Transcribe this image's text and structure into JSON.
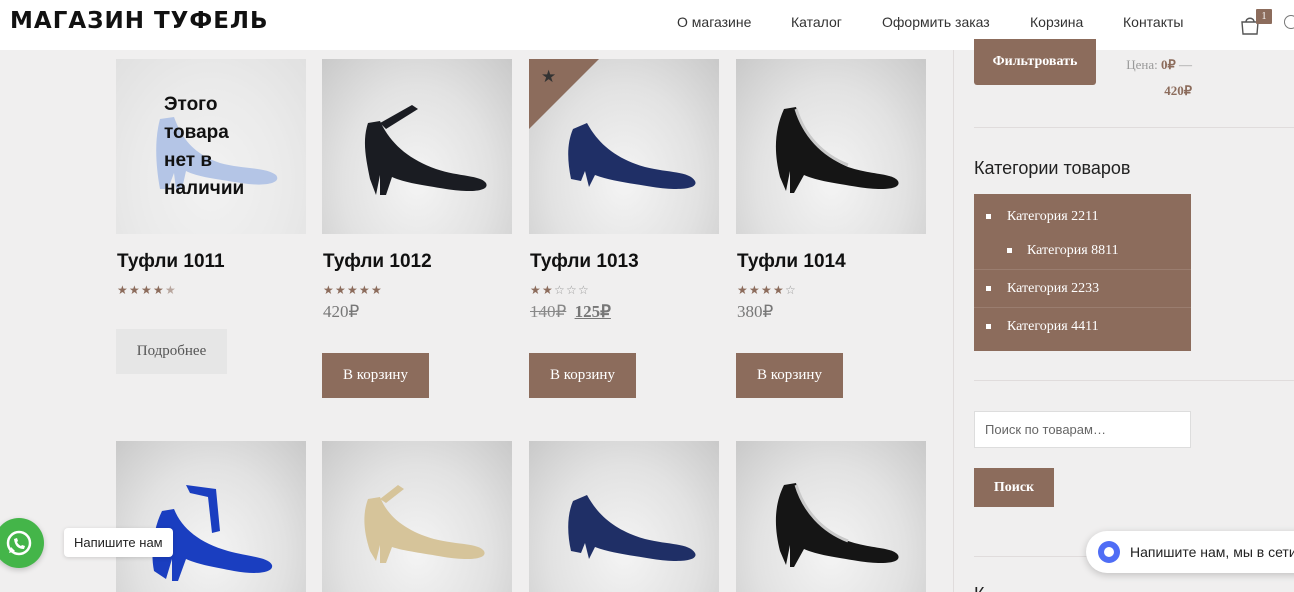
{
  "header": {
    "logo": "МАГАЗИН ТУФЕЛЬ",
    "nav": [
      "О магазине",
      "Каталог",
      "Оформить заказ",
      "Корзина",
      "Контакты"
    ],
    "cart_count": "1"
  },
  "products": [
    {
      "title": "Туфли 1011",
      "rating": 4.5,
      "price": "",
      "out_of_stock": "Этого товара нет в наличии",
      "button": "Подробнее",
      "color": "#5b86d8"
    },
    {
      "title": "Туфли 1012",
      "rating": 5,
      "price": "420₽",
      "button": "В корзину",
      "color": "#1a1c22"
    },
    {
      "title": "Туфли 1013",
      "rating": 2,
      "old_price": "140₽",
      "new_price": "125₽",
      "featured": true,
      "button": "В корзину",
      "color": "#1f2f66"
    },
    {
      "title": "Туфли 1014",
      "rating": 4,
      "price": "380₽",
      "button": "В корзину",
      "color": "#151515"
    }
  ],
  "row2_colors": [
    "#1a3ec0",
    "#d6c49a",
    "#1f2f66",
    "#151515"
  ],
  "sidebar": {
    "filter_button": "Фильтровать",
    "price_label": "Цена:",
    "price_min": "0₽",
    "price_sep": "—",
    "price_max": "420₽",
    "categories_title": "Категории товаров",
    "categories": [
      "Категория 2211",
      "Категория 8811",
      "Категория 2233",
      "Категория 4411"
    ],
    "search_placeholder": "Поиск по товарам…",
    "search_button": "Поиск",
    "next_widget_letter": "К"
  },
  "widgets": {
    "whatsapp_label": "Напишите нам",
    "chat_label": "Напишите нам, мы в сети!"
  },
  "colors": {
    "accent": "#8c6c5c",
    "whatsapp": "#44b549",
    "chat": "#4f6df5"
  }
}
